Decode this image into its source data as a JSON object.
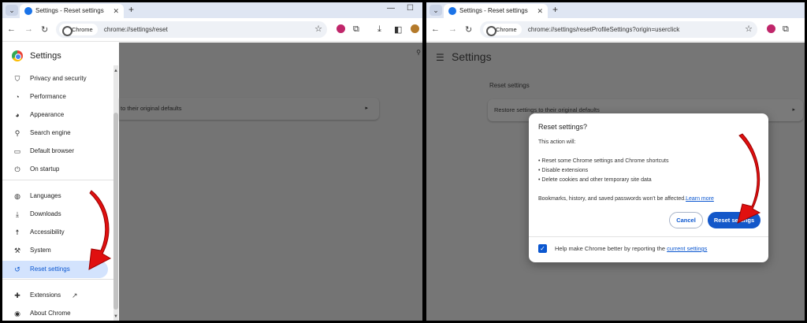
{
  "left": {
    "tab_title": "Settings - Reset settings",
    "chip_label": "Chrome",
    "url": "chrome://settings/reset",
    "sidebar_title": "Settings",
    "sidebar_items": [
      {
        "label": "Privacy and security",
        "icon": "shield-icon"
      },
      {
        "label": "Performance",
        "icon": "speedometer-icon"
      },
      {
        "label": "Appearance",
        "icon": "palette-icon"
      },
      {
        "label": "Search engine",
        "icon": "search-icon"
      },
      {
        "label": "Default browser",
        "icon": "browser-icon"
      },
      {
        "label": "On startup",
        "icon": "power-icon"
      },
      {
        "label": "Languages",
        "icon": "globe-icon"
      },
      {
        "label": "Downloads",
        "icon": "download-icon"
      },
      {
        "label": "Accessibility",
        "icon": "accessibility-icon"
      },
      {
        "label": "System",
        "icon": "wrench-icon"
      },
      {
        "label": "Reset settings",
        "icon": "history-icon"
      },
      {
        "label": "Extensions",
        "icon": "puzzle-icon"
      },
      {
        "label": "About Chrome",
        "icon": "chrome-icon"
      }
    ],
    "row_text": "to their original defaults"
  },
  "right": {
    "tab_title": "Settings - Reset settings",
    "chip_label": "Chrome",
    "url": "chrome://settings/resetProfileSettings?origin=userclick",
    "header_title": "Settings",
    "section_title": "Reset settings",
    "row_text": "Restore settings to their original defaults",
    "dialog": {
      "title": "Reset settings?",
      "intro": "This action will:",
      "bullets": [
        "• Reset some Chrome settings and Chrome shortcuts",
        "• Disable extensions",
        "• Delete cookies and other temporary site data"
      ],
      "note": "Bookmarks, history, and saved passwords won't be affected.",
      "learn_more": "Learn more",
      "cancel": "Cancel",
      "reset": "Reset settings",
      "checkbox_text": "Help make Chrome better by reporting the ",
      "checkbox_link": "current settings",
      "checkbox_checked": true
    }
  },
  "colors": {
    "accent": "#0b57d0",
    "overlay": "#767676",
    "arrow": "#e01010"
  }
}
